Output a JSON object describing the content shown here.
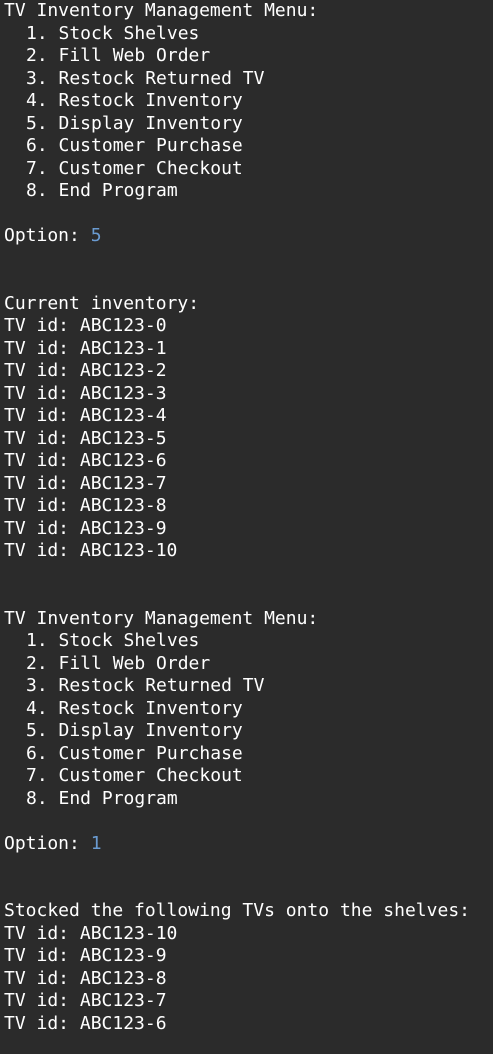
{
  "colors": {
    "background": "#2b2b2b",
    "text": "#ffffff",
    "input_value": "#6a9bd1"
  },
  "session1": {
    "menu_title": "TV Inventory Management Menu:",
    "menu_items": [
      "1. Stock Shelves",
      "2. Fill Web Order",
      "3. Restock Returned TV",
      "4. Restock Inventory",
      "5. Display Inventory",
      "6. Customer Purchase",
      "7. Customer Checkout",
      "8. End Program"
    ],
    "option_label": "Option: ",
    "option_value": "5",
    "output_header": "Current inventory:",
    "output_lines": [
      "TV id: ABC123-0",
      "TV id: ABC123-1",
      "TV id: ABC123-2",
      "TV id: ABC123-3",
      "TV id: ABC123-4",
      "TV id: ABC123-5",
      "TV id: ABC123-6",
      "TV id: ABC123-7",
      "TV id: ABC123-8",
      "TV id: ABC123-9",
      "TV id: ABC123-10"
    ]
  },
  "session2": {
    "menu_title": "TV Inventory Management Menu:",
    "menu_items": [
      "1. Stock Shelves",
      "2. Fill Web Order",
      "3. Restock Returned TV",
      "4. Restock Inventory",
      "5. Display Inventory",
      "6. Customer Purchase",
      "7. Customer Checkout",
      "8. End Program"
    ],
    "option_label": "Option: ",
    "option_value": "1",
    "output_header": "Stocked the following TVs onto the shelves:",
    "output_lines": [
      "TV id: ABC123-10",
      "TV id: ABC123-9",
      "TV id: ABC123-8",
      "TV id: ABC123-7",
      "TV id: ABC123-6"
    ]
  }
}
